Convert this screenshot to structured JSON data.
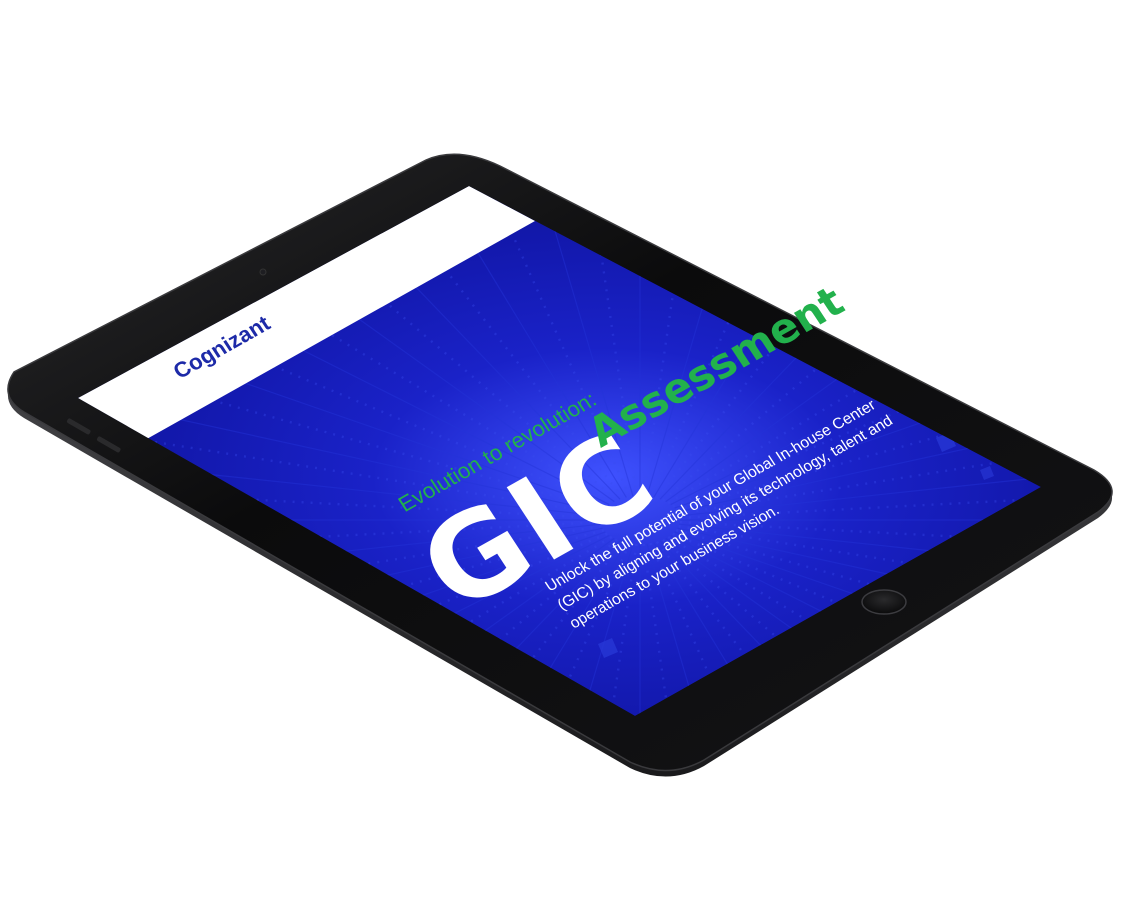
{
  "device": {
    "brand_logo": "Cognizant",
    "tagline": "Evolution to revolution:",
    "title_main": "GIC",
    "title_sub": "Assessment",
    "body_lines": [
      "Unlock the full potential of your Global In-house Center",
      "(GIC) by aligning and evolving its technology, talent and",
      "operations to your business vision."
    ]
  },
  "colors": {
    "bezel": "#0b0b0c",
    "screen_bg": "#0f12a8",
    "accent_green": "#22b14c",
    "logo_blue": "#1d2aa8",
    "text_white": "#ffffff"
  },
  "icons": {
    "home_button": "home-button-icon",
    "camera": "camera-icon"
  }
}
